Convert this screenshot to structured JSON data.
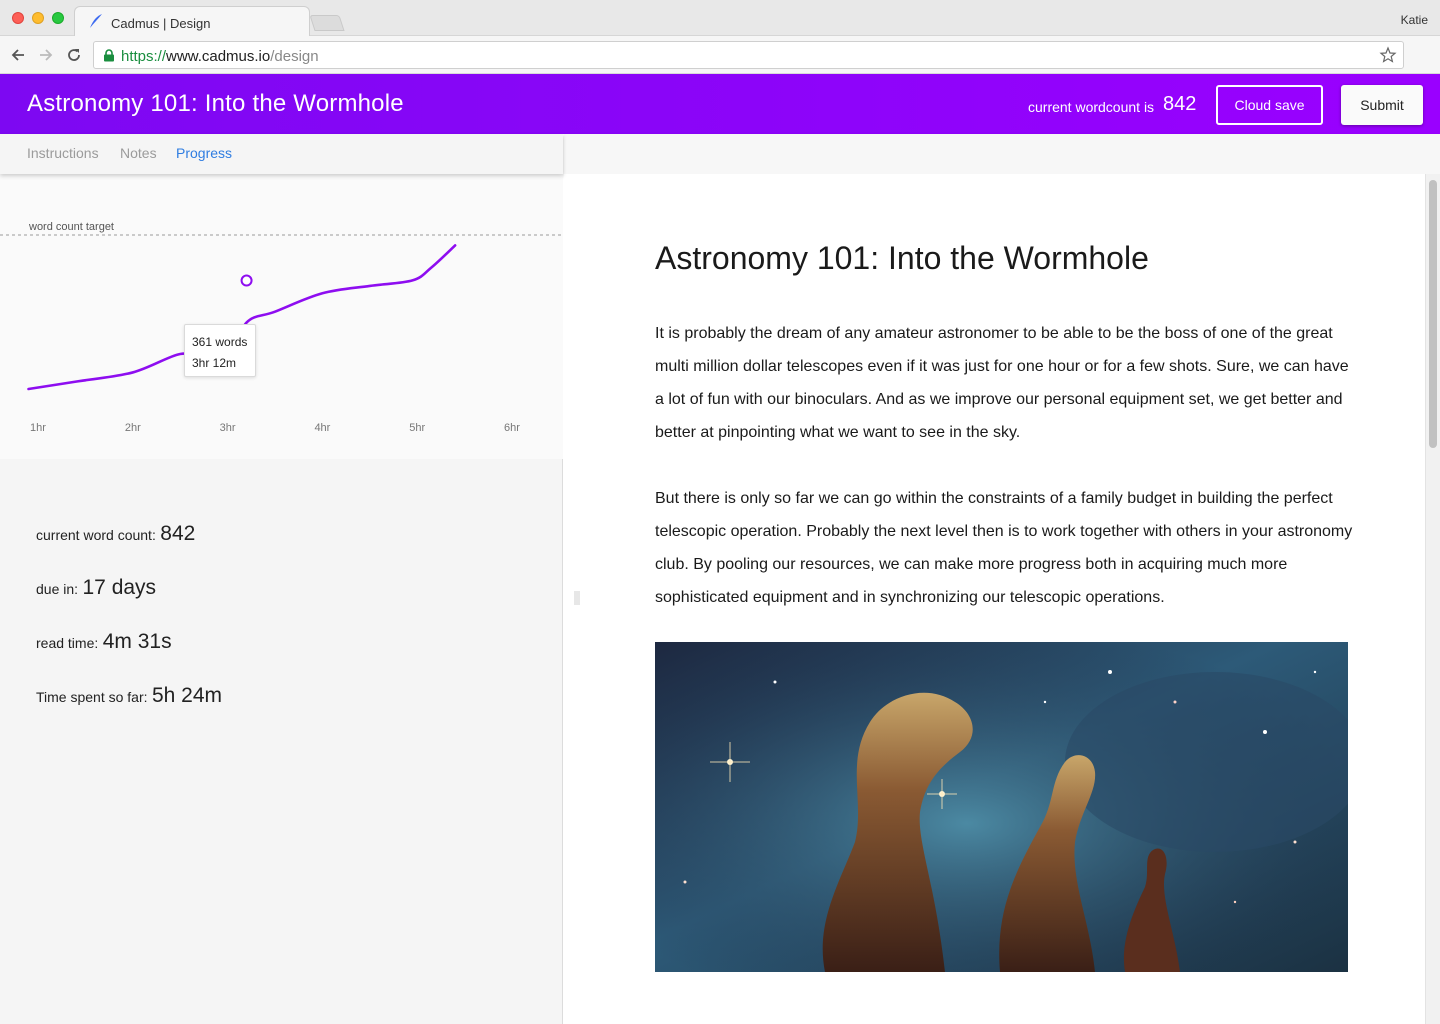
{
  "browser": {
    "tab_title": "Cadmus | Design",
    "profile_name": "Katie",
    "url": {
      "protocol": "https://",
      "host": "www.cadmus.io",
      "path": "/design"
    }
  },
  "header": {
    "title": "Astronomy 101: Into the Wormhole",
    "wordcount_label": "current wordcount is",
    "wordcount_value": "842",
    "cloud_save_label": "Cloud save",
    "submit_label": "Submit",
    "accent_color": "#8a05f8"
  },
  "sidebar": {
    "tabs": [
      {
        "label": "Instructions",
        "active": false
      },
      {
        "label": "Notes",
        "active": false
      },
      {
        "label": "Progress",
        "active": true
      }
    ],
    "stats": [
      {
        "label": "current word count:",
        "value": "842"
      },
      {
        "label": "due in:",
        "value": "17 days"
      },
      {
        "label": "read time:",
        "value": "4m 31s"
      },
      {
        "label": "Time spent so far:",
        "value": "5h 24m"
      }
    ]
  },
  "chart_data": {
    "type": "line",
    "target_label": "word count target",
    "x_ticks": [
      "1hr",
      "2hr",
      "3hr",
      "4hr",
      "5hr",
      "6hr"
    ],
    "xlim": [
      0.9,
      6.0
    ],
    "ylim": [
      0,
      842
    ],
    "series": [
      {
        "color": "#8e0df0",
        "x": [
          0.9,
          1.4,
          2.0,
          2.5,
          2.75,
          3.0,
          3.2,
          3.5,
          4.0,
          4.5,
          4.95,
          5.15,
          5.4
        ],
        "y": [
          0,
          40,
          90,
          190,
          160,
          160,
          361,
          420,
          520,
          560,
          590,
          660,
          780
        ]
      }
    ],
    "tooltip": {
      "x": 3.2,
      "words": "361 words",
      "time": "3hr 12m"
    },
    "grid": false
  },
  "document": {
    "title": "Astronomy 101: Into the Wormhole",
    "paragraphs": [
      "It is probably the dream of any amateur astronomer to be able to be the boss of one of the great multi million dollar telescopes even if it was just for one hour or for a few shots. Sure, we can have a lot of fun with our binoculars. And as we improve our personal equipment set, we get better and better at pinpointing what we want to see in the sky.",
      "But there is only so far we can go within the constraints of a family budget in building the perfect telescopic operation. Probably the next level then is to work together with others in your astronomy club. By pooling our resources, we can make more progress both in acquiring much more sophisticated equipment and in synchronizing our telescopic operations."
    ],
    "image_subject": "nebula-pillars-image"
  }
}
